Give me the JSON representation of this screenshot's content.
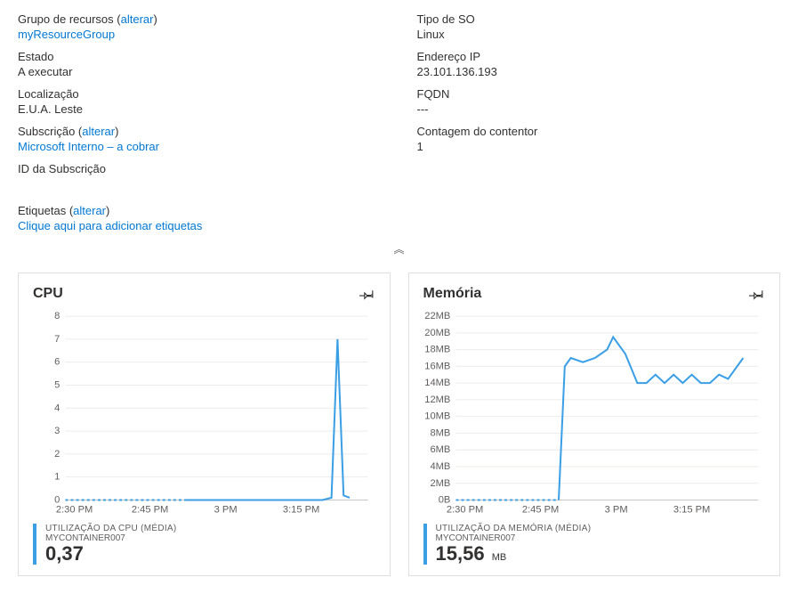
{
  "props": {
    "left": [
      {
        "label": "Grupo de recursos",
        "changeLink": "alterar",
        "valueLink": "myResourceGroup"
      },
      {
        "label": "Estado",
        "value": "A executar"
      },
      {
        "label": "Localização",
        "value": "E.U.A. Leste"
      },
      {
        "label": "Subscrição",
        "changeLink": "alterar",
        "valueLink": "Microsoft Interno – a cobrar"
      },
      {
        "label": "ID da Subscrição",
        "value": ""
      }
    ],
    "right": [
      {
        "label": "Tipo de SO",
        "value": "Linux"
      },
      {
        "label": "Endereço IP",
        "value": "23.101.136.193"
      },
      {
        "label": "FQDN",
        "value": "---"
      },
      {
        "label": "Contagem do contentor",
        "value": "1"
      }
    ],
    "tags": {
      "label": "Etiquetas",
      "changeLink": "alterar",
      "addLink": "Clique aqui para adicionar etiquetas"
    }
  },
  "collapseGlyph": "︽",
  "charts": {
    "cpu": {
      "title": "CPU",
      "metricLabel": "UTILIZAÇÃO DA CPU (MÉDIA)",
      "metricSub": "MYCONTAINER007",
      "metricValue": "0,37",
      "metricUnit": ""
    },
    "mem": {
      "title": "Memória",
      "metricLabel": "UTILIZAÇÃO DA MEMÓRIA (MÉDIA)",
      "metricSub": "MYCONTAINER007",
      "metricValue": "15,56",
      "metricUnit": "MB"
    }
  },
  "chart_data": [
    {
      "id": "cpu",
      "type": "line",
      "title": "CPU",
      "xlabel": "",
      "ylabel": "",
      "ylim": [
        0,
        8
      ],
      "yticks": [
        0,
        1,
        2,
        3,
        4,
        5,
        6,
        7,
        8
      ],
      "xticks": [
        "2:30 PM",
        "2:45 PM",
        "3 PM",
        "3:15 PM"
      ],
      "series": [
        {
          "name": "UTILIZAÇÃO DA CPU (MÉDIA) MYCONTAINER007",
          "x": [
            0.0,
            0.05,
            0.1,
            0.15,
            0.2,
            0.25,
            0.3,
            0.35,
            0.4,
            0.45,
            0.5,
            0.55,
            0.6,
            0.65,
            0.7,
            0.75,
            0.8,
            0.82,
            0.85,
            0.88,
            0.9,
            0.92,
            0.94
          ],
          "y": [
            0.0,
            0.0,
            0.0,
            0.0,
            0.0,
            0.0,
            0.0,
            0.0,
            0.0,
            0.0,
            0.0,
            0.0,
            0.0,
            0.0,
            0.0,
            0.0,
            0.0,
            0.0,
            0.0,
            0.1,
            7.0,
            0.2,
            0.1
          ],
          "dotted_until_index": 8
        }
      ]
    },
    {
      "id": "mem",
      "type": "line",
      "title": "Memória",
      "xlabel": "",
      "ylabel": "",
      "ylim": [
        0,
        22
      ],
      "yticks": [
        0,
        2,
        4,
        6,
        8,
        10,
        12,
        14,
        16,
        18,
        20,
        22
      ],
      "ytick_labels": [
        "0B",
        "2MB",
        "4MB",
        "6MB",
        "8MB",
        "10MB",
        "12MB",
        "14MB",
        "16MB",
        "18MB",
        "20MB",
        "22MB"
      ],
      "xticks": [
        "2:30 PM",
        "2:45 PM",
        "3 PM",
        "3:15 PM"
      ],
      "series": [
        {
          "name": "UTILIZAÇÃO DA MEMÓRIA (MÉDIA) MYCONTAINER007",
          "x": [
            0.0,
            0.05,
            0.1,
            0.15,
            0.2,
            0.25,
            0.3,
            0.34,
            0.36,
            0.38,
            0.42,
            0.46,
            0.5,
            0.52,
            0.56,
            0.6,
            0.63,
            0.66,
            0.69,
            0.72,
            0.75,
            0.78,
            0.81,
            0.84,
            0.87,
            0.9,
            0.93,
            0.95
          ],
          "y": [
            0.0,
            0.0,
            0.0,
            0.0,
            0.0,
            0.0,
            0.0,
            0.0,
            16.0,
            17.0,
            16.5,
            17.0,
            18.0,
            19.5,
            17.5,
            14.0,
            14.0,
            15.0,
            14.0,
            15.0,
            14.0,
            15.0,
            14.0,
            14.0,
            15.0,
            14.5,
            16.0,
            17.0
          ],
          "dotted_until_index": 7
        }
      ]
    }
  ]
}
